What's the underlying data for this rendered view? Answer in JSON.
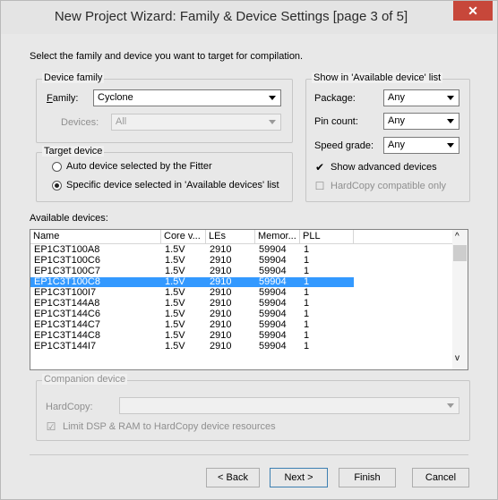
{
  "window": {
    "title": "New Project Wizard: Family & Device Settings [page 3 of 5]",
    "close_glyph": "✕"
  },
  "intro_text": "Select the family and device you want to target for compilation.",
  "device_family": {
    "legend": "Device family",
    "family_label": "Family:",
    "family_value": "Cyclone",
    "devices_label": "Devices:",
    "devices_value": "All"
  },
  "target_device": {
    "legend": "Target device",
    "auto_label": "Auto device selected by the Fitter",
    "specific_label": "Specific device selected in 'Available devices' list",
    "selected": "specific"
  },
  "show_filters": {
    "legend": "Show in 'Available device' list",
    "package_label": "Package:",
    "package_value": "Any",
    "pin_count_label": "Pin count:",
    "pin_count_value": "Any",
    "speed_grade_label": "Speed grade:",
    "speed_grade_value": "Any",
    "show_advanced_label": "Show advanced devices",
    "show_advanced_checked": true,
    "hardcopy_label": "HardCopy compatible only",
    "hardcopy_checked": false
  },
  "available_devices": {
    "label": "Available devices:",
    "columns": [
      "Name",
      "Core v...",
      "LEs",
      "Memor...",
      "PLL"
    ],
    "rows": [
      [
        "EP1C3T100A8",
        "1.5V",
        "2910",
        "59904",
        "1"
      ],
      [
        "EP1C3T100C6",
        "1.5V",
        "2910",
        "59904",
        "1"
      ],
      [
        "EP1C3T100C7",
        "1.5V",
        "2910",
        "59904",
        "1"
      ],
      [
        "EP1C3T100C8",
        "1.5V",
        "2910",
        "59904",
        "1"
      ],
      [
        "EP1C3T100I7",
        "1.5V",
        "2910",
        "59904",
        "1"
      ],
      [
        "EP1C3T144A8",
        "1.5V",
        "2910",
        "59904",
        "1"
      ],
      [
        "EP1C3T144C6",
        "1.5V",
        "2910",
        "59904",
        "1"
      ],
      [
        "EP1C3T144C7",
        "1.5V",
        "2910",
        "59904",
        "1"
      ],
      [
        "EP1C3T144C8",
        "1.5V",
        "2910",
        "59904",
        "1"
      ],
      [
        "EP1C3T144I7",
        "1.5V",
        "2910",
        "59904",
        "1"
      ]
    ],
    "selected_index": 3
  },
  "companion": {
    "legend": "Companion device",
    "hardcopy_label": "HardCopy:",
    "hardcopy_value": "",
    "limit_label": "Limit DSP & RAM to HardCopy device resources",
    "limit_checked": true
  },
  "buttons": {
    "back": "< Back",
    "next": "Next >",
    "finish": "Finish",
    "cancel": "Cancel"
  },
  "colors": {
    "selection": "#3399ff",
    "close_button": "#c7473a"
  }
}
